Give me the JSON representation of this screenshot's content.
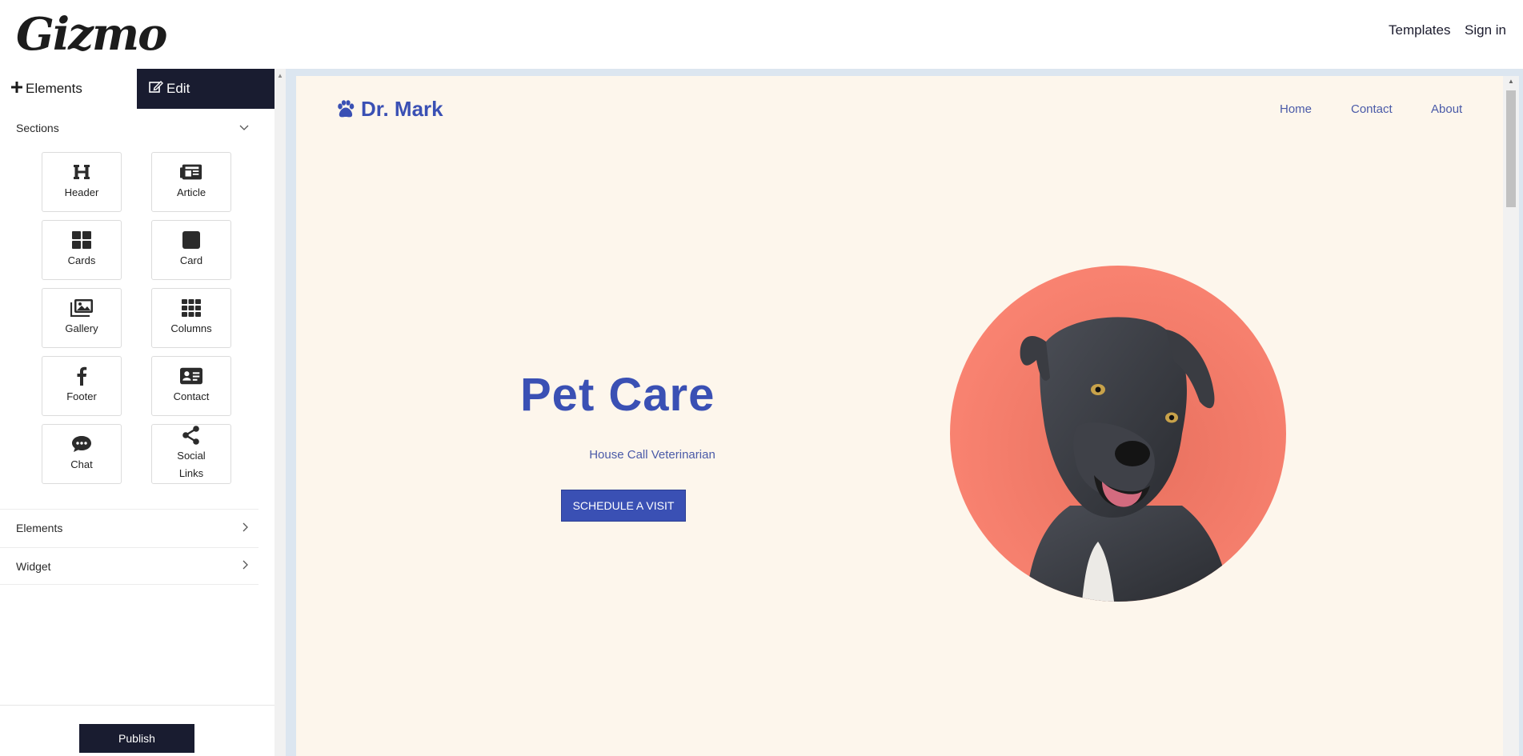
{
  "app": {
    "logo": "Gizmo",
    "top_links": {
      "templates": "Templates",
      "signin": "Sign in"
    }
  },
  "panel": {
    "tabs": {
      "elements": "Elements",
      "edit": "Edit"
    },
    "sections_label": "Sections",
    "tiles": [
      {
        "label": "Header",
        "icon": "heading-icon"
      },
      {
        "label": "Article",
        "icon": "newspaper-icon"
      },
      {
        "label": "Cards",
        "icon": "grid-four-icon"
      },
      {
        "label": "Card",
        "icon": "square-icon"
      },
      {
        "label": "Gallery",
        "icon": "images-icon"
      },
      {
        "label": "Columns",
        "icon": "grid-nine-icon"
      },
      {
        "label": "Footer",
        "icon": "facebook-icon"
      },
      {
        "label": "Contact",
        "icon": "id-card-icon"
      },
      {
        "label": "Chat",
        "icon": "chat-bubble-icon"
      },
      {
        "label": "Social Links",
        "icon": "share-icon"
      }
    ],
    "elements_label": "Elements",
    "widget_label": "Widget",
    "publish_label": "Publish"
  },
  "site": {
    "logo_text": "Dr. Mark",
    "nav": {
      "home": "Home",
      "contact": "Contact",
      "about": "About"
    },
    "hero": {
      "title": "Pet Care",
      "subtitle": "House Call Veterinarian",
      "button": "SCHEDULE A VISIT"
    }
  },
  "colors": {
    "dark": "#191c30",
    "accent": "#3a50b4",
    "site_bg": "#fdf6ec",
    "circle": "#fa8472"
  }
}
